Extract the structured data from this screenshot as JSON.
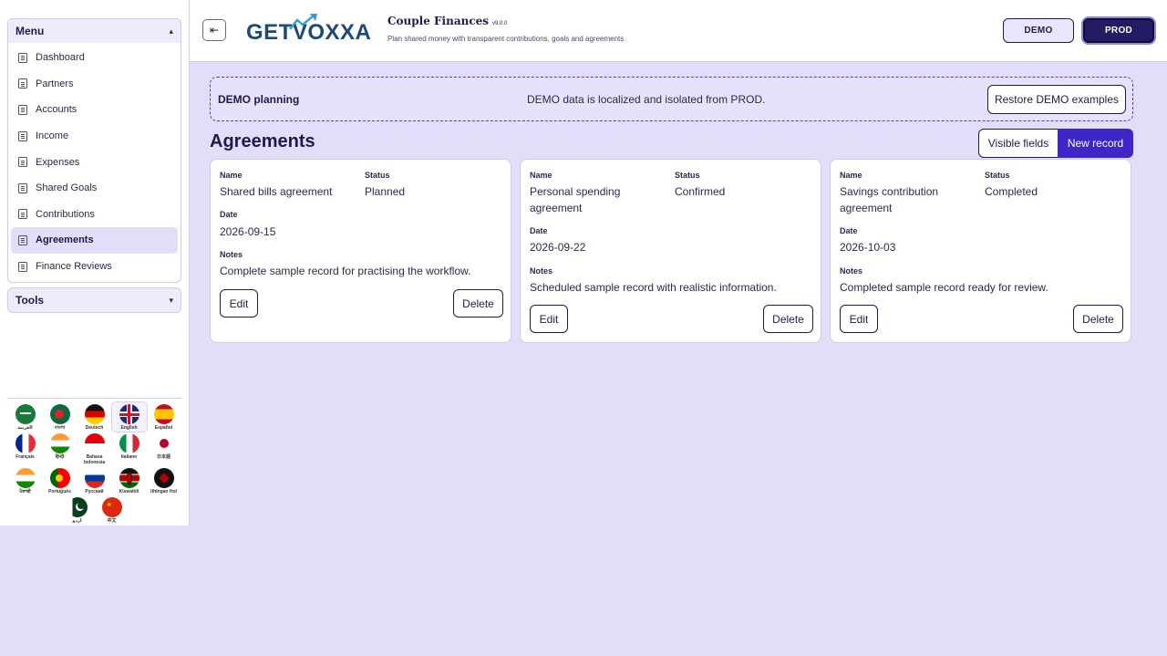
{
  "sidebar": {
    "menu_title": "Menu",
    "items": [
      {
        "label": "Dashboard",
        "active": false
      },
      {
        "label": "Partners",
        "active": false
      },
      {
        "label": "Accounts",
        "active": false
      },
      {
        "label": "Income",
        "active": false
      },
      {
        "label": "Expenses",
        "active": false
      },
      {
        "label": "Shared Goals",
        "active": false
      },
      {
        "label": "Contributions",
        "active": false
      },
      {
        "label": "Agreements",
        "active": true
      },
      {
        "label": "Finance Reviews",
        "active": false
      }
    ],
    "tools_title": "Tools",
    "languages": [
      "العربية",
      "বাংলা",
      "Deutsch",
      "English",
      "Español",
      "Français",
      "हिन्दी",
      "Bahasa Indonesia",
      "Italiano",
      "日本語",
      "ਪੰਜਾਬੀ",
      "Português",
      "Русский",
      "Kiswahili",
      "tlhIngan Hol",
      "اردو",
      "中文"
    ],
    "active_language": "English"
  },
  "header": {
    "logo_text_1": "GET",
    "logo_text_2": "V",
    "logo_text_3": "OXXA",
    "app_title": "Couple Finances",
    "app_version": "v9.0.0",
    "app_subtitle": "Plan shared money with transparent contributions, goals and agreements",
    "env_demo": "DEMO",
    "env_prod": "PROD"
  },
  "banner": {
    "title": "DEMO planning",
    "message": "DEMO data is localized and isolated from PROD.",
    "restore_label": "Restore DEMO examples"
  },
  "page": {
    "title": "Agreements",
    "visible_fields_label": "Visible fields",
    "new_record_label": "New record"
  },
  "field_labels": {
    "name": "Name",
    "status": "Status",
    "date": "Date",
    "notes": "Notes"
  },
  "actions": {
    "edit": "Edit",
    "delete": "Delete"
  },
  "records": [
    {
      "name_line1": "Shared bills agreement",
      "name_line2": "",
      "status": "Planned",
      "date": "2026-09-15",
      "notes": "Complete sample record for practising the workflow."
    },
    {
      "name_line1": "Personal spending",
      "name_line2": "agreement",
      "status": "Confirmed",
      "date": "2026-09-22",
      "notes": "Scheduled sample record with realistic information."
    },
    {
      "name_line1": "Savings contribution",
      "name_line2": "agreement",
      "status": "Completed",
      "date": "2026-10-03",
      "notes": "Completed sample record ready for review."
    }
  ],
  "colors": {
    "accent": "#3d27c9",
    "background": "#e2defa",
    "text": "#1e1b4b"
  }
}
